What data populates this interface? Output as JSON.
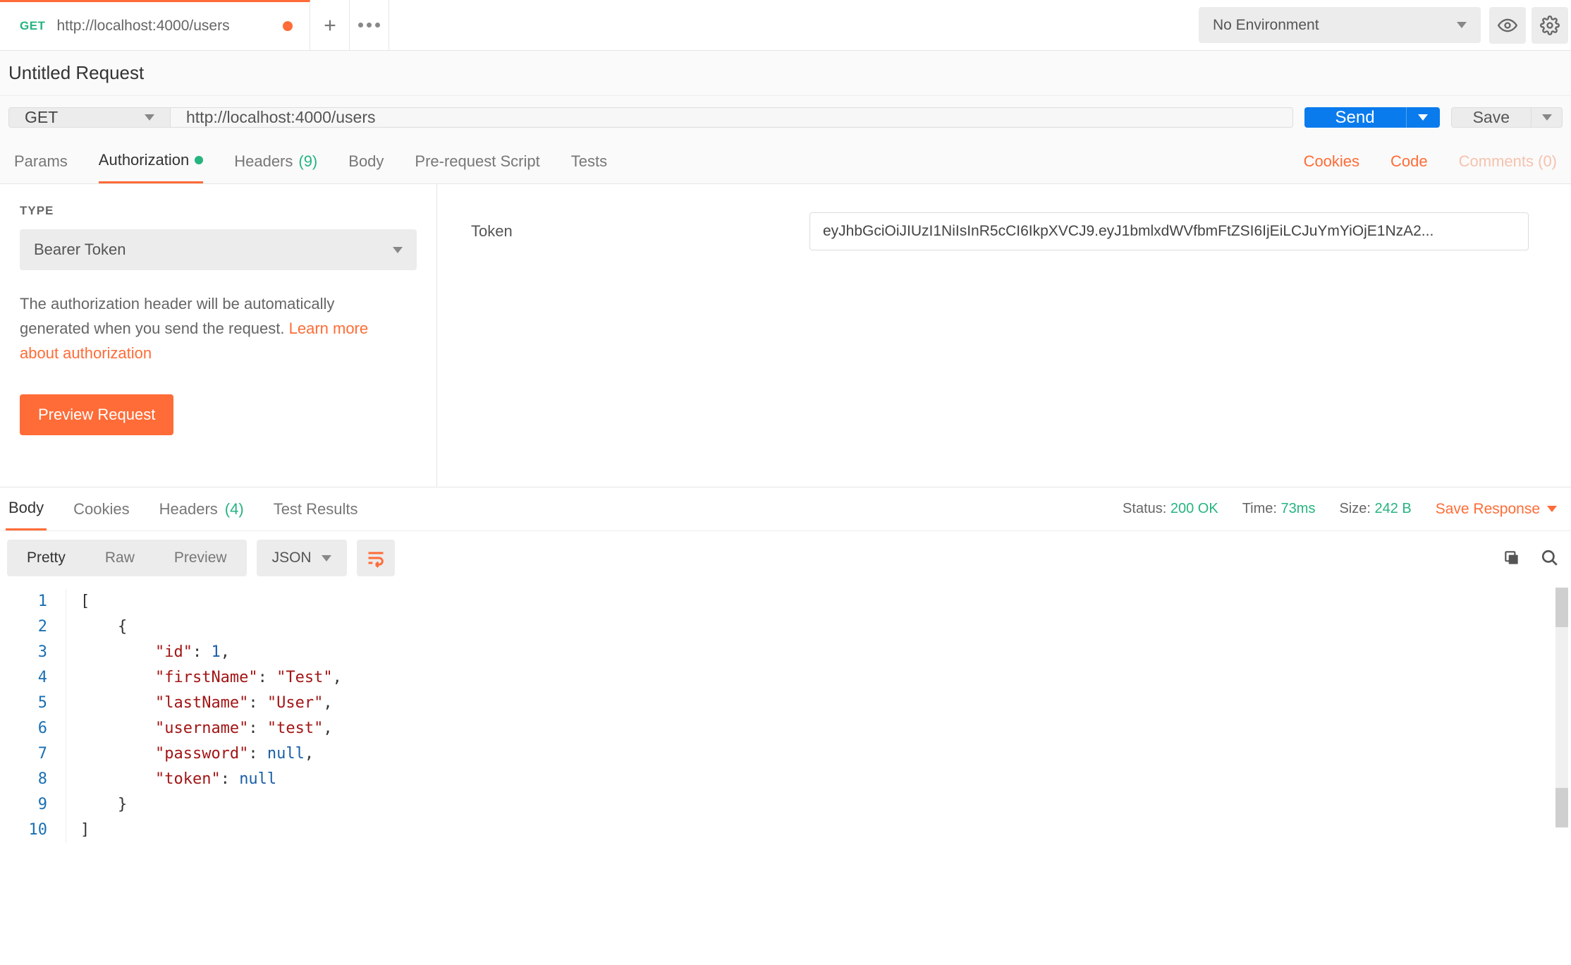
{
  "topbar": {
    "tab_method": "GET",
    "tab_url": "http://localhost:4000/users",
    "environment": "No Environment"
  },
  "request": {
    "title": "Untitled Request",
    "method": "GET",
    "url": "http://localhost:4000/users",
    "send_label": "Send",
    "save_label": "Save"
  },
  "reqtabs": {
    "params": "Params",
    "authorization": "Authorization",
    "headers": "Headers",
    "headers_count": "(9)",
    "body": "Body",
    "prerequest": "Pre-request Script",
    "tests": "Tests",
    "cookies": "Cookies",
    "code": "Code",
    "comments": "Comments (0)"
  },
  "auth": {
    "type_label": "TYPE",
    "type_value": "Bearer Token",
    "desc_1": "The authorization header will be automatically generated when you send the request. ",
    "desc_link": "Learn more about authorization",
    "preview_label": "Preview Request",
    "token_label": "Token",
    "token_value": "eyJhbGciOiJIUzI1NiIsInR5cCI6IkpXVCJ9.eyJ1bmlxdWVfbmFtZSI6IjEiLCJuYmYiOjE1NzA2..."
  },
  "restabs": {
    "body": "Body",
    "cookies": "Cookies",
    "headers": "Headers",
    "headers_count": "(4)",
    "test_results": "Test Results",
    "status_label": "Status:",
    "status_value": "200 OK",
    "time_label": "Time:",
    "time_value": "73ms",
    "size_label": "Size:",
    "size_value": "242 B",
    "save_response": "Save Response"
  },
  "restool": {
    "pretty": "Pretty",
    "raw": "Raw",
    "preview": "Preview",
    "format": "JSON"
  },
  "code_lines": [
    "1",
    "2",
    "3",
    "4",
    "5",
    "6",
    "7",
    "8",
    "9",
    "10"
  ],
  "json_tokens": [
    [
      [
        "p",
        "["
      ]
    ],
    [
      [
        "p",
        "    {"
      ]
    ],
    [
      [
        "p",
        "        "
      ],
      [
        "k",
        "\"id\""
      ],
      [
        "p",
        ": "
      ],
      [
        "n",
        "1"
      ],
      [
        "p",
        ","
      ]
    ],
    [
      [
        "p",
        "        "
      ],
      [
        "k",
        "\"firstName\""
      ],
      [
        "p",
        ": "
      ],
      [
        "v",
        "\"Test\""
      ],
      [
        "p",
        ","
      ]
    ],
    [
      [
        "p",
        "        "
      ],
      [
        "k",
        "\"lastName\""
      ],
      [
        "p",
        ": "
      ],
      [
        "v",
        "\"User\""
      ],
      [
        "p",
        ","
      ]
    ],
    [
      [
        "p",
        "        "
      ],
      [
        "k",
        "\"username\""
      ],
      [
        "p",
        ": "
      ],
      [
        "v",
        "\"test\""
      ],
      [
        "p",
        ","
      ]
    ],
    [
      [
        "p",
        "        "
      ],
      [
        "k",
        "\"password\""
      ],
      [
        "p",
        ": "
      ],
      [
        "n",
        "null"
      ],
      [
        "p",
        ","
      ]
    ],
    [
      [
        "p",
        "        "
      ],
      [
        "k",
        "\"token\""
      ],
      [
        "p",
        ": "
      ],
      [
        "n",
        "null"
      ]
    ],
    [
      [
        "p",
        "    }"
      ]
    ],
    [
      [
        "p",
        "]"
      ]
    ]
  ]
}
